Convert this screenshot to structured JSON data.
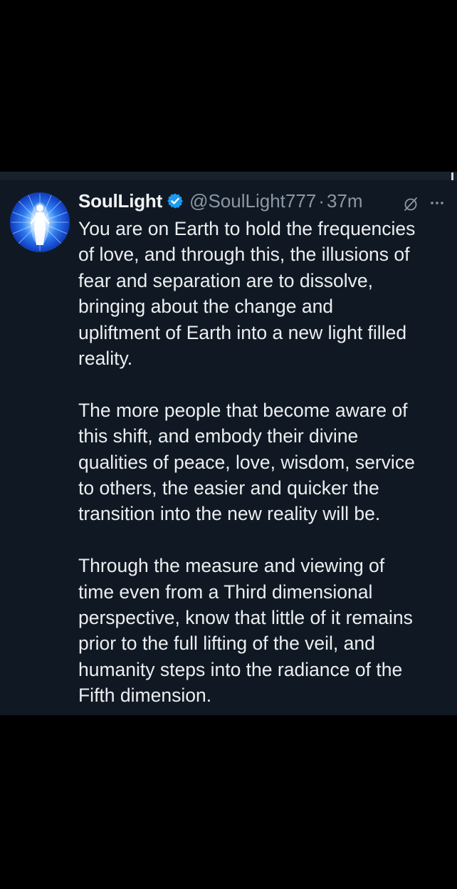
{
  "tweet": {
    "display_name": "SoulLight",
    "handle": "@SoulLight777",
    "separator": "·",
    "timestamp": "37m",
    "icons": {
      "verified": "verified-badge-icon",
      "grok": "grok-icon",
      "more": "more-options-icon"
    },
    "paragraphs": [
      "You are on Earth to hold the frequencies\nof love, and through this, the illusions of\nfear and separation are to dissolve,\nbringing about the change and\nupliftment of Earth into a new light filled\nreality.",
      "The more people that become aware of\nthis shift, and embody their divine\nqualities of peace, love, wisdom, service\nto others, the easier and quicker the\ntransition into the new reality will be.",
      "Through the measure and viewing of\ntime even from a Third dimensional\nperspective, know that little of it remains\nprior to the full lifting of the veil, and\nhumanity  steps into the radiance of the\nFifth dimension."
    ]
  },
  "colors": {
    "background": "#000000",
    "card": "#101923",
    "text_primary": "#eceef0",
    "text_secondary": "#8b98a5",
    "verified_blue": "#1d9bf0"
  }
}
